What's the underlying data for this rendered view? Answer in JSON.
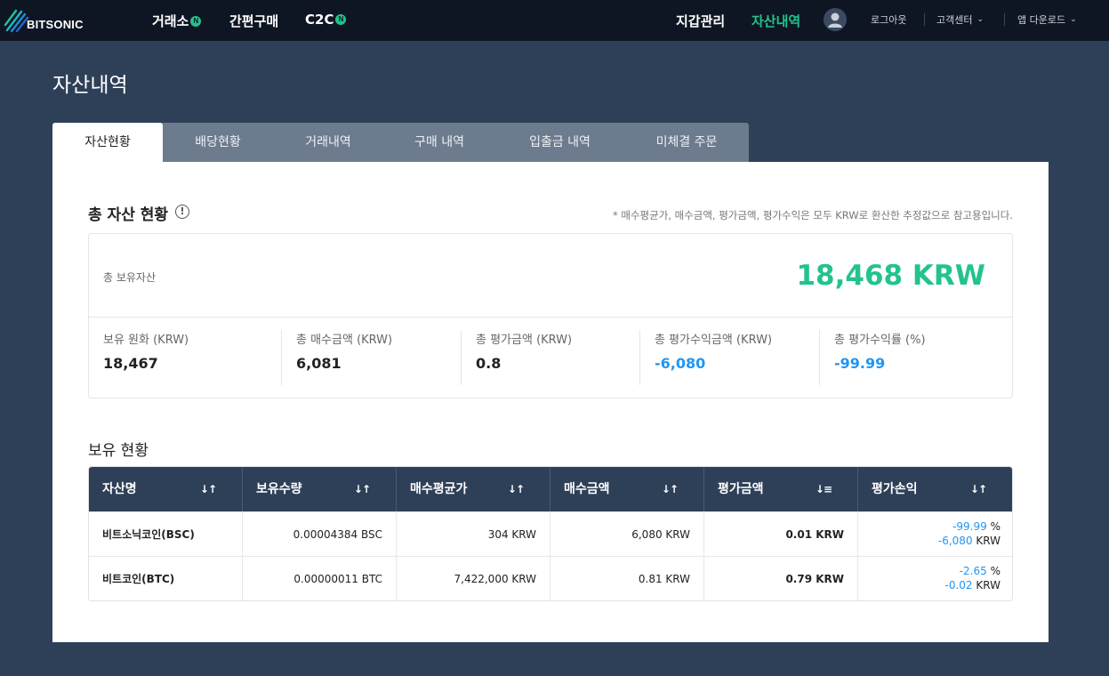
{
  "brand": {
    "name": "BITSONIC"
  },
  "nav": {
    "exchange": "거래소",
    "exchange_badge": "N",
    "quick_buy": "간편구매",
    "c2c": "C2C",
    "c2c_badge": "N",
    "wallet": "지갑관리",
    "assets": "자산내역",
    "logout": "로그아웃",
    "support": "고객센터",
    "app_download": "앱 다운로드",
    "active_color": "#22c38e"
  },
  "page": {
    "title": "자산내역"
  },
  "tabs": [
    "자산현황",
    "배당현황",
    "거래내역",
    "구매 내역",
    "입출금 내역",
    "미체결 주문"
  ],
  "summary": {
    "title": "총 자산 현황",
    "info_icon": "!",
    "notice": "* 매수평균가, 매수금액, 평가금액, 평가수익은 모두 KRW로 환산한 추정값으로 참고용입니다.",
    "total_label": "총 보유자산",
    "total_value": "18,468 KRW",
    "metrics": [
      {
        "label": "보유 원화 (KRW)",
        "value": "18,467"
      },
      {
        "label": "총 매수금액 (KRW)",
        "value": "6,081"
      },
      {
        "label": "총 평가금액 (KRW)",
        "value": "0.8"
      },
      {
        "label": "총 평가수익금액 (KRW)",
        "value": "-6,080"
      },
      {
        "label": "총 평가수익률 (%)",
        "value": "-99.99"
      }
    ]
  },
  "holdings": {
    "title": "보유 현황",
    "columns": [
      "자산명",
      "보유수량",
      "매수평균가",
      "매수금액",
      "평가금액",
      "평가손익"
    ],
    "rows": [
      {
        "name": "비트소닉코인(BSC)",
        "quantity": "0.00004384 BSC",
        "avg_price": "304 KRW",
        "buy_amount": "6,080 KRW",
        "eval_amount": "0.01 KRW",
        "pl_rate": "-99.99",
        "pl_rate_unit": "%",
        "pl_amount": "-6,080",
        "pl_amount_unit": "KRW"
      },
      {
        "name": "비트코인(BTC)",
        "quantity": "0.00000011 BTC",
        "avg_price": "7,422,000 KRW",
        "buy_amount": "0.81 KRW",
        "eval_amount": "0.79 KRW",
        "pl_rate": "-2.65",
        "pl_rate_unit": "%",
        "pl_amount": "-0.02",
        "pl_amount_unit": "KRW"
      }
    ]
  }
}
